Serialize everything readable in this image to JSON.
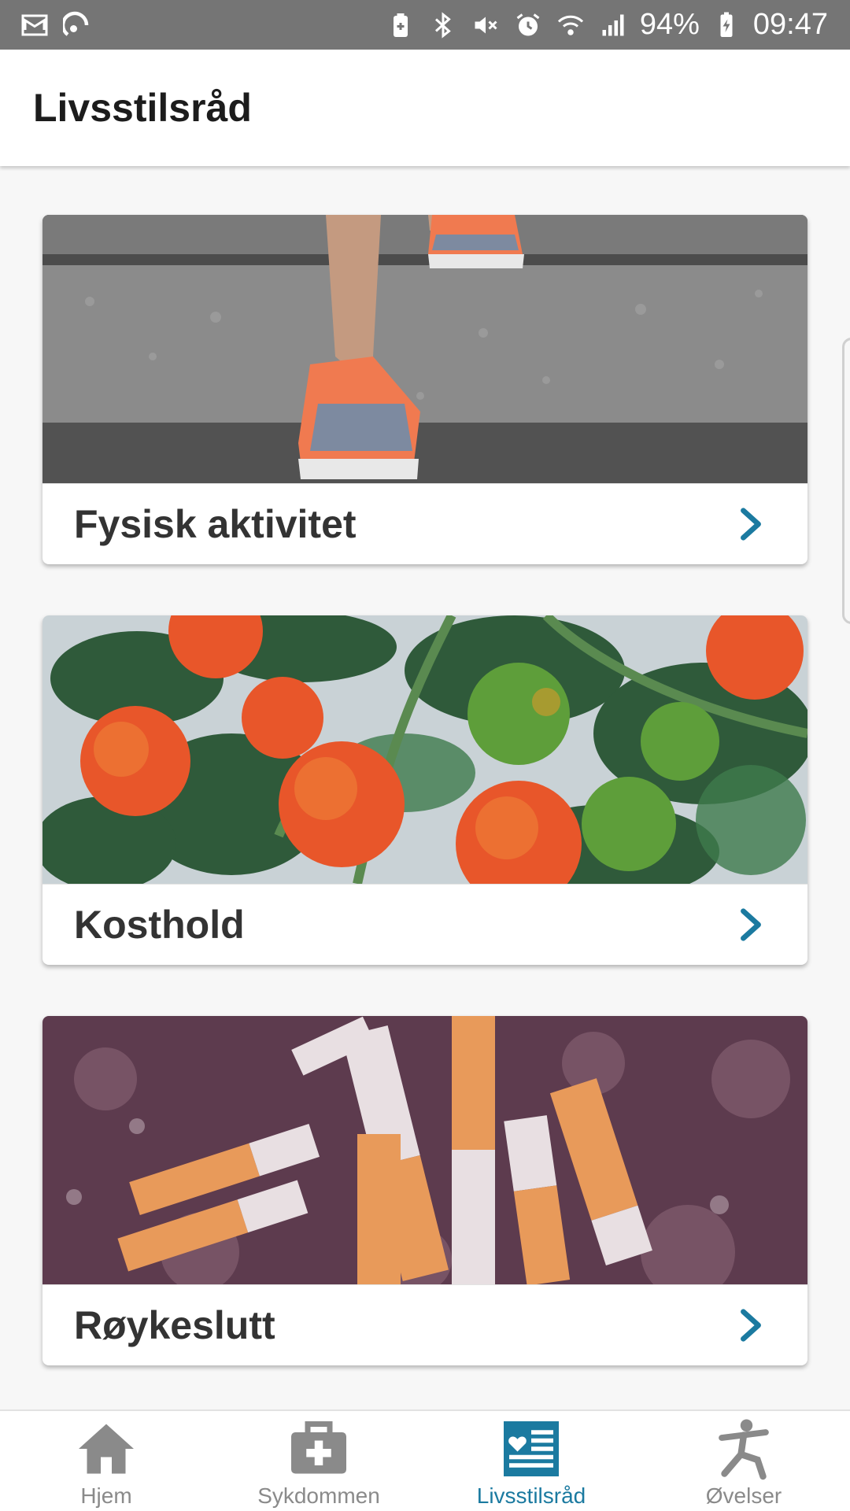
{
  "status_bar": {
    "battery": "94%",
    "time": "09:47",
    "icons_left": [
      "mail-icon",
      "sync-icon"
    ],
    "icons_right": [
      "battery-saver-icon",
      "bluetooth-icon",
      "mute-icon",
      "alarm-icon",
      "wifi-icon",
      "signal-icon",
      "battery-icon"
    ]
  },
  "header": {
    "title": "Livsstilsråd"
  },
  "cards": [
    {
      "title": "Fysisk aktivitet",
      "image": "running-shoes-on-stairs-photo",
      "icon": "chevron-right-icon"
    },
    {
      "title": "Kosthold",
      "image": "tomatoes-on-vine-photo",
      "icon": "chevron-right-icon"
    },
    {
      "title": "Røykeslutt",
      "image": "cigarette-butts-photo",
      "icon": "chevron-right-icon"
    }
  ],
  "bottom_nav": {
    "items": [
      {
        "label": "Hjem",
        "icon": "home-icon",
        "active": false
      },
      {
        "label": "Sykdommen",
        "icon": "medical-kit-icon",
        "active": false
      },
      {
        "label": "Livsstilsråd",
        "icon": "article-heart-icon",
        "active": true
      },
      {
        "label": "Øvelser",
        "icon": "exercise-person-icon",
        "active": false
      }
    ]
  },
  "colors": {
    "accent": "#1b7aa0",
    "status_bar": "#757575",
    "inactive": "#8a8a8a",
    "chevron": "#1b7aa0"
  }
}
